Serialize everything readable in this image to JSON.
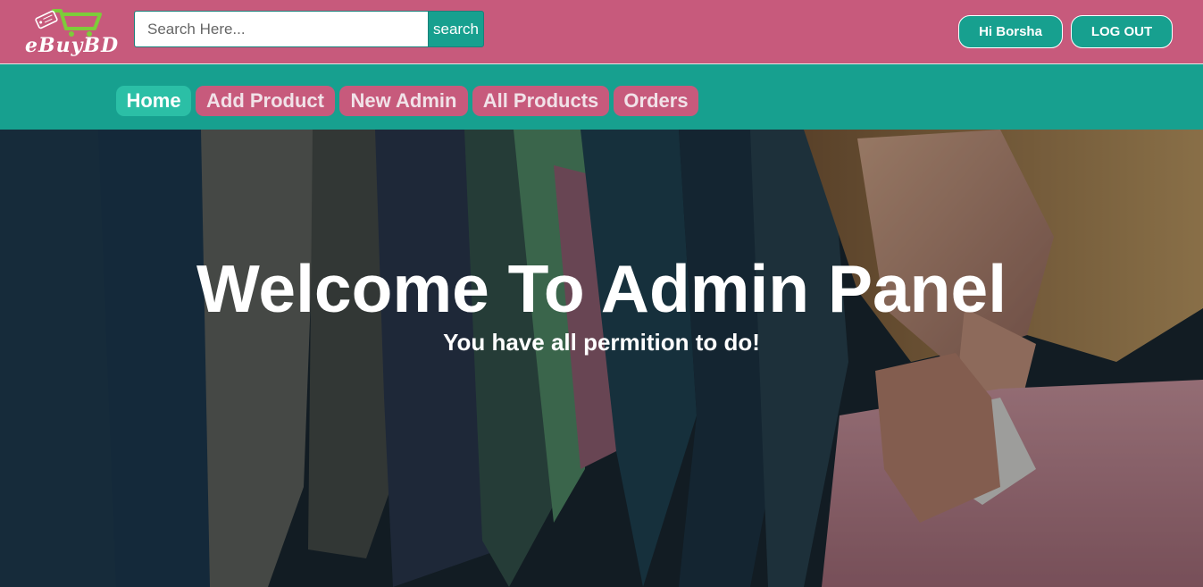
{
  "brand": {
    "name": "eBuyBD",
    "logo_icon": "shopping-cart-icon"
  },
  "search": {
    "placeholder": "Search Here...",
    "value": "",
    "button_label": "search"
  },
  "user": {
    "greeting": "Hi Borsha",
    "logout_label": "LOG OUT"
  },
  "nav": {
    "items": [
      {
        "label": "Home",
        "active": true
      },
      {
        "label": "Add Product",
        "active": false
      },
      {
        "label": "New Admin",
        "active": false
      },
      {
        "label": "All Products",
        "active": false
      },
      {
        "label": "Orders",
        "active": false
      }
    ]
  },
  "hero": {
    "title": "Welcome To Admin Panel",
    "subtitle": "You have all permition to do!"
  },
  "colors": {
    "header_pink": "#c75a7c",
    "nav_teal": "#17a08f",
    "active_tab": "#2bbfa6",
    "logo_green": "#7dcc3a"
  }
}
